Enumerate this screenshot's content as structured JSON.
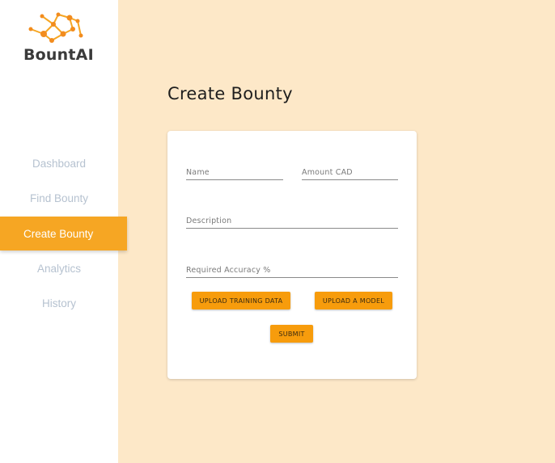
{
  "app": {
    "brand": "BountAI",
    "accent_color": "#f6a623",
    "button_color": "#f79c0c"
  },
  "sidebar": {
    "items": [
      {
        "label": "Dashboard",
        "active": false
      },
      {
        "label": "Find Bounty",
        "active": false
      },
      {
        "label": "Create Bounty",
        "active": true
      },
      {
        "label": "Analytics",
        "active": false
      },
      {
        "label": "History",
        "active": false
      }
    ]
  },
  "main": {
    "title": "Create Bounty",
    "form": {
      "name_placeholder": "Name",
      "amount_placeholder": "Amount CAD",
      "description_placeholder": "Description",
      "accuracy_placeholder": "Required Accuracy %",
      "upload_training_label": "UPLOAD TRAINING DATA",
      "upload_model_label": "UPLOAD A MODEL",
      "submit_label": "SUBMIT"
    }
  }
}
